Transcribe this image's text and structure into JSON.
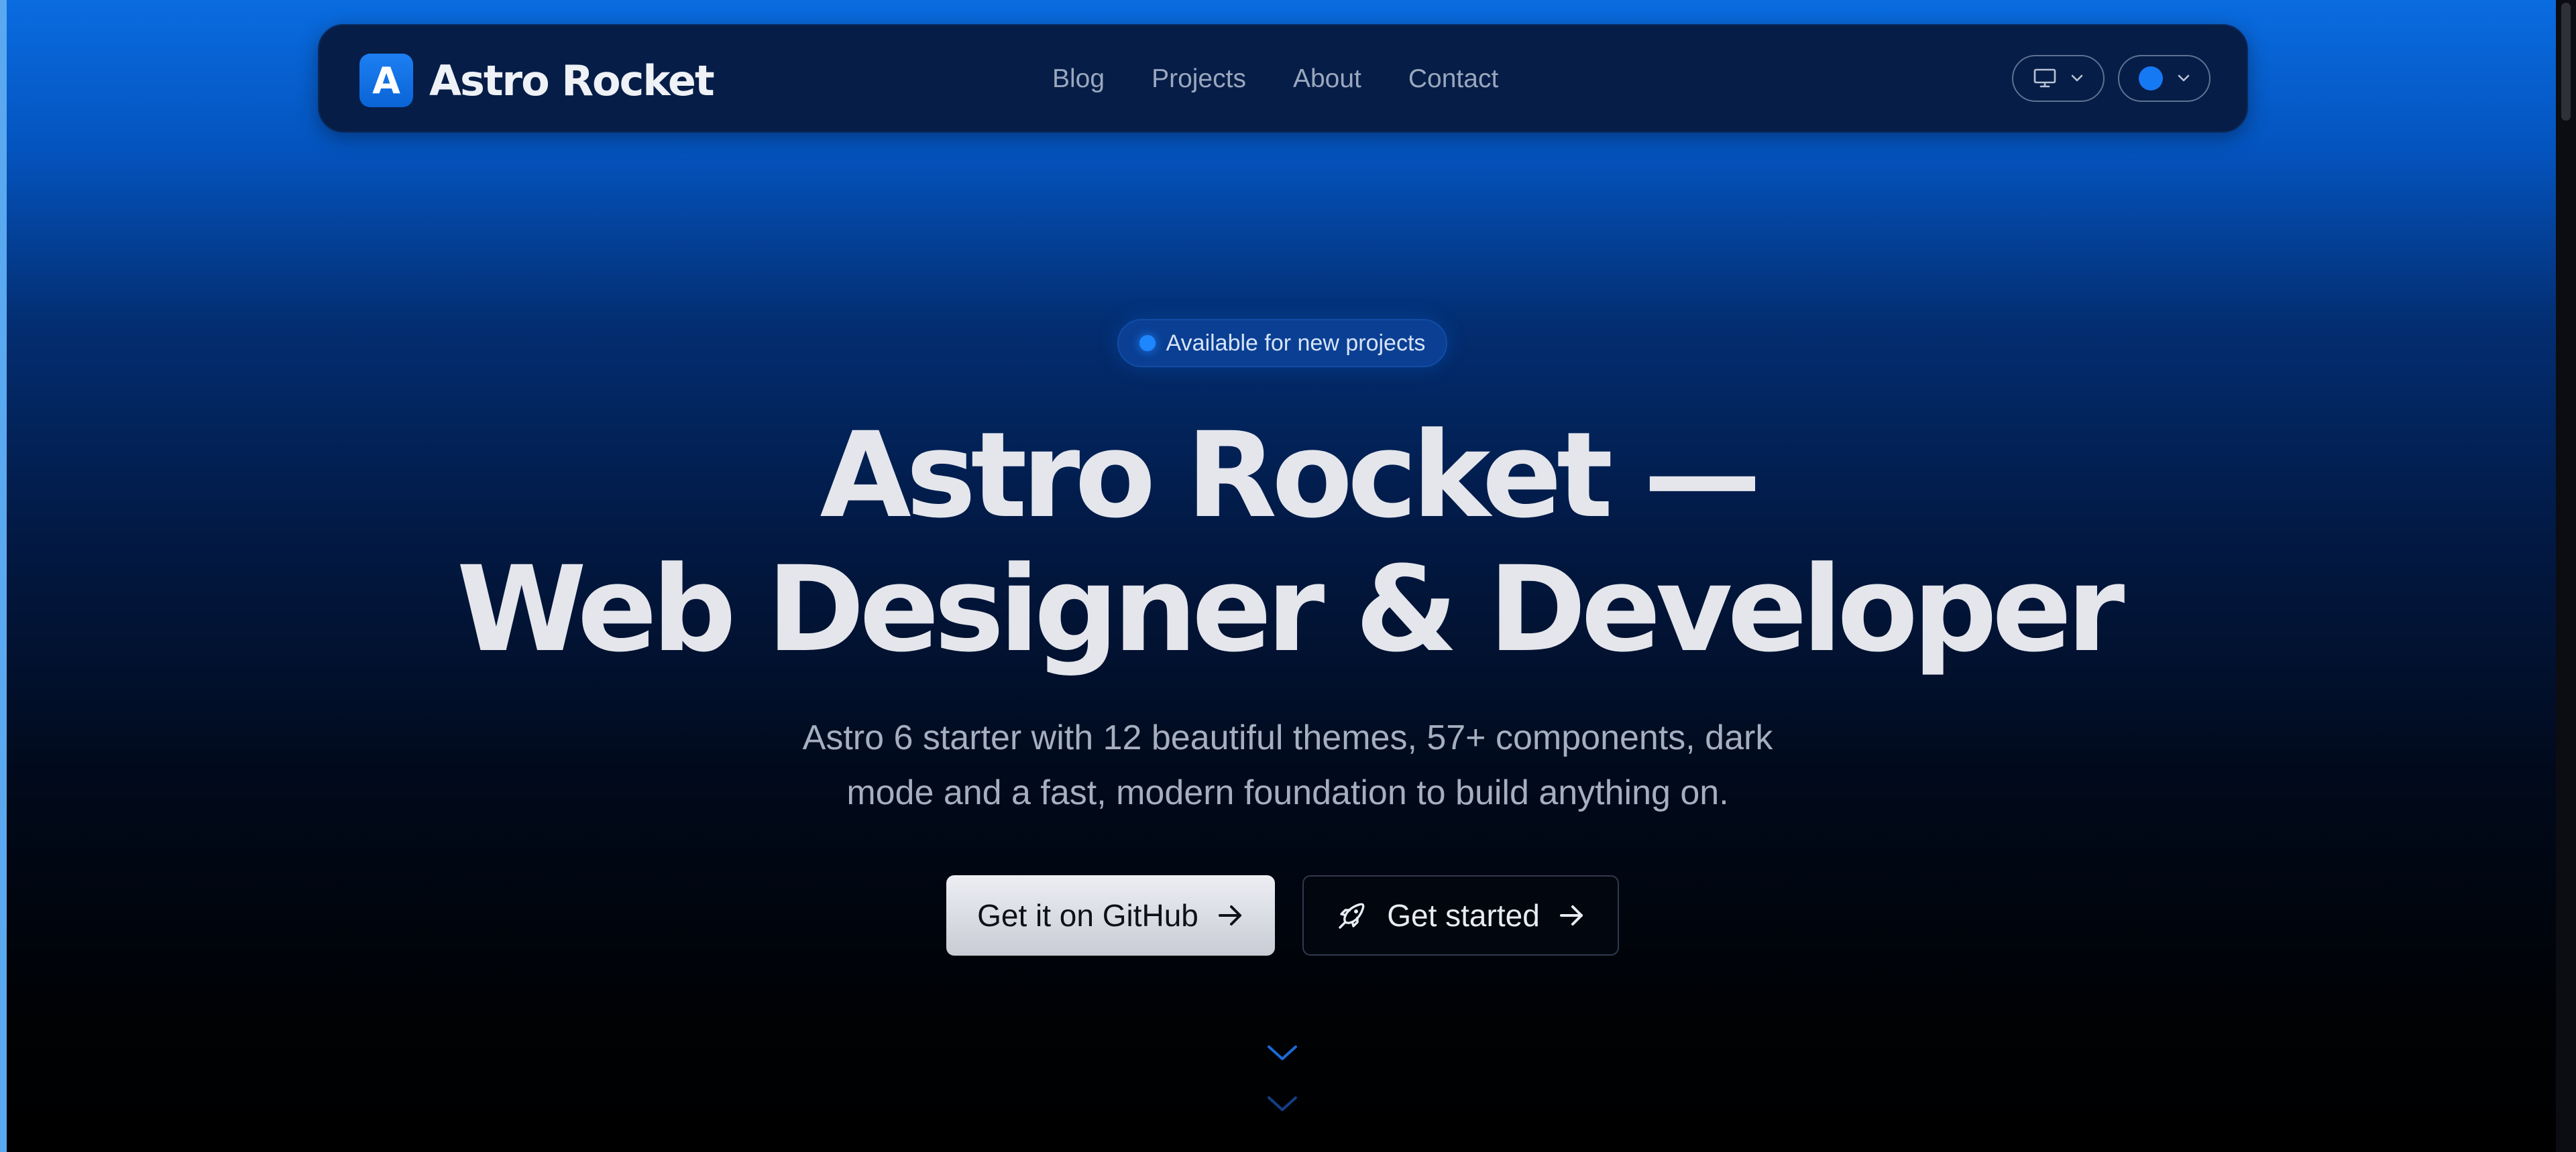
{
  "brand": {
    "logo_letter": "A",
    "name": "Astro Rocket"
  },
  "nav": {
    "items": [
      {
        "label": "Blog"
      },
      {
        "label": "Projects"
      },
      {
        "label": "About"
      },
      {
        "label": "Contact"
      }
    ]
  },
  "controls": {
    "display_icon": "monitor-icon",
    "color_icon": "color-dot",
    "accent_color": "#1679f4"
  },
  "hero": {
    "badge": "Available for new projects",
    "title_line1": "Astro Rocket —",
    "title_line2": "Web Designer & Developer",
    "subtitle_line1": "Astro 6 starter with 12 beautiful themes, 57+ components, dark",
    "subtitle_line2": "mode and a fast, modern foundation to build anything on.",
    "primary_button": "Get it on GitHub",
    "secondary_button": "Get started"
  },
  "colors": {
    "brand_blue": "#0a6ce0",
    "header_bg": "#061d47",
    "text_light": "#e4e6ec"
  }
}
